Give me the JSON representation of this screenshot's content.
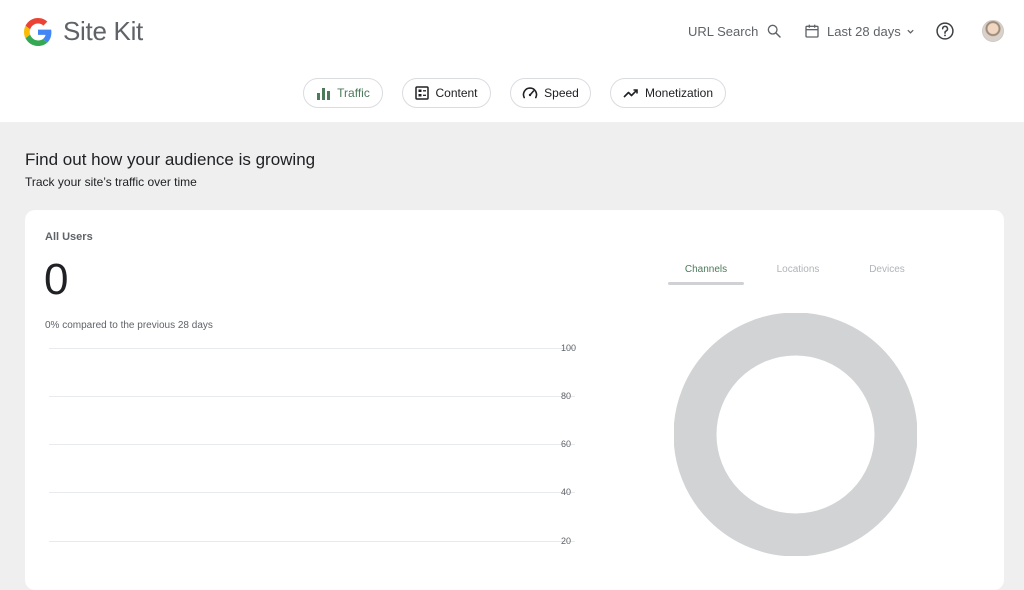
{
  "header": {
    "brand": "Site Kit",
    "url_search_label": "URL Search",
    "date_range_label": "Last 28 days"
  },
  "nav_tabs": [
    {
      "label": "Traffic",
      "icon": "bar-chart-icon",
      "active": true
    },
    {
      "label": "Content",
      "icon": "content-icon",
      "active": false
    },
    {
      "label": "Speed",
      "icon": "speed-icon",
      "active": false
    },
    {
      "label": "Monetization",
      "icon": "trending-up-icon",
      "active": false
    }
  ],
  "section": {
    "title": "Find out how your audience is growing",
    "subtitle": "Track your site’s traffic over time"
  },
  "card": {
    "label": "All Users",
    "value": "0",
    "comparison": "0% compared to the previous 28 days",
    "dimension_tabs": [
      {
        "label": "Channels",
        "active": true
      },
      {
        "label": "Locations",
        "active": false
      },
      {
        "label": "Devices",
        "active": false
      }
    ]
  },
  "chart_data": {
    "type": "line",
    "y_ticks": [
      "100",
      "80",
      "60",
      "40",
      "20"
    ],
    "ylim": [
      0,
      100
    ],
    "series": []
  },
  "colors": {
    "accent": "#4c7a5a",
    "page_background": "#efefef",
    "donut_empty": "#d1d3d4"
  }
}
